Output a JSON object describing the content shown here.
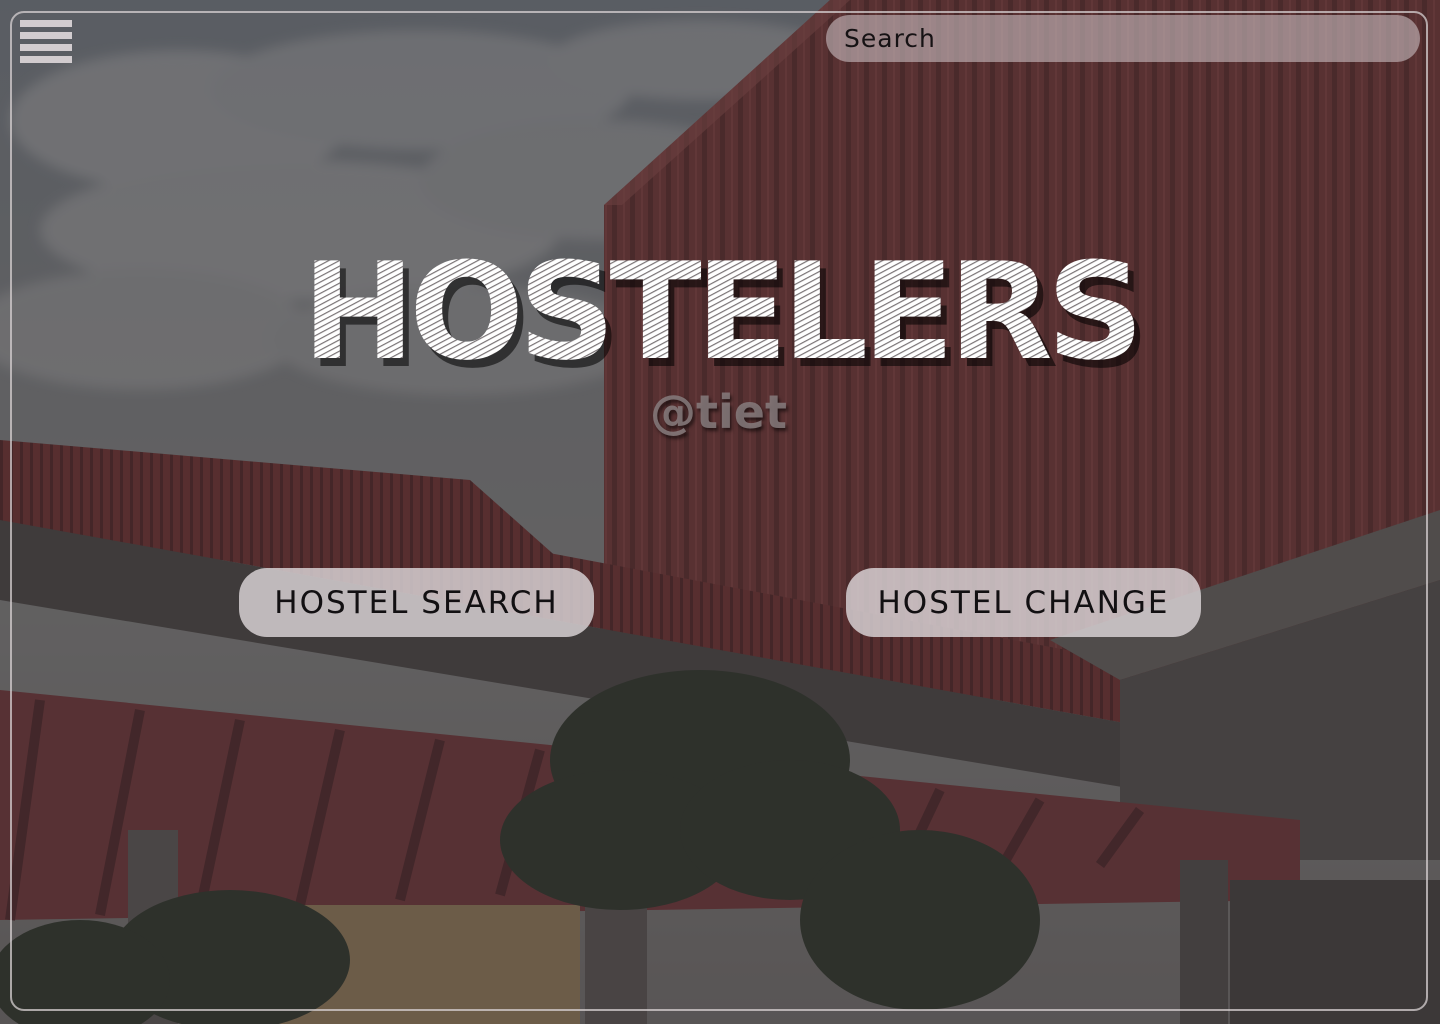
{
  "header": {
    "menu_icon": "hamburger-menu-icon",
    "search": {
      "placeholder": "Search",
      "value": ""
    }
  },
  "hero": {
    "title": "HOSTELERS",
    "subtitle": "@tiet"
  },
  "actions": {
    "hostel_search_label": "HOSTEL SEARCH",
    "hostel_change_label": "HOSTEL CHANGE"
  },
  "theme": {
    "overlay": "#2e2a2c",
    "building_red": "#8a3a3a",
    "sky": "#7c8a96",
    "button_bg": "#dcd6d8",
    "text_dark": "#121012"
  }
}
